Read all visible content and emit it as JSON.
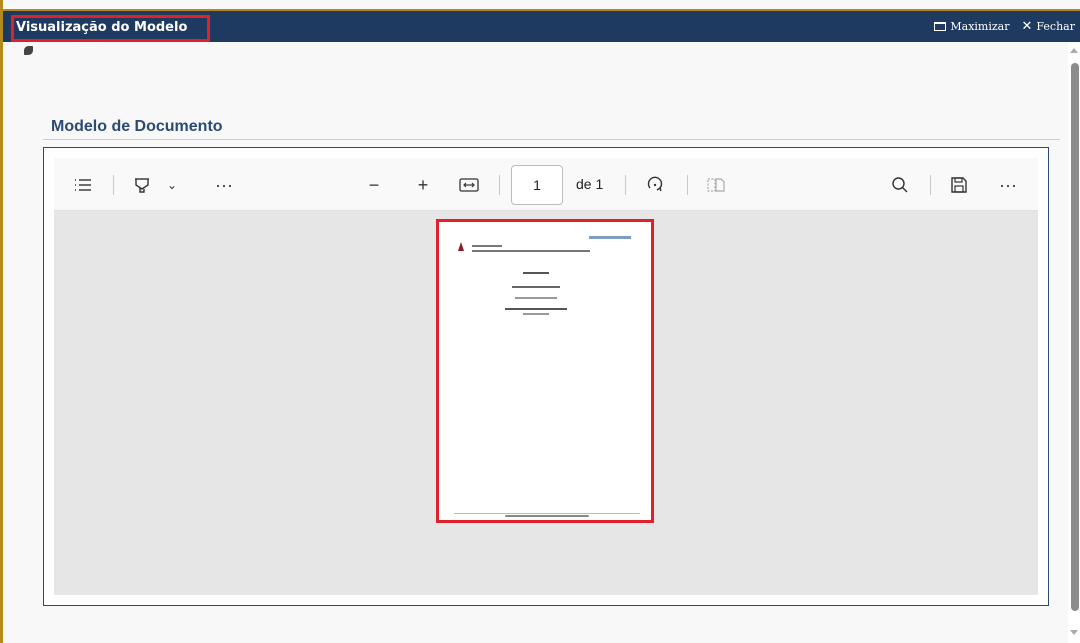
{
  "window": {
    "title": "Visualização do Modelo",
    "maximize_label": "Maximizar",
    "close_label": "Fechar"
  },
  "section": {
    "title": "Modelo de Documento"
  },
  "pdf_toolbar": {
    "page_number": "1",
    "page_of": "de 1"
  },
  "colors": {
    "titlebar": "#1f3a60",
    "highlight": "#e0202a",
    "section_title": "#2b4a75"
  }
}
